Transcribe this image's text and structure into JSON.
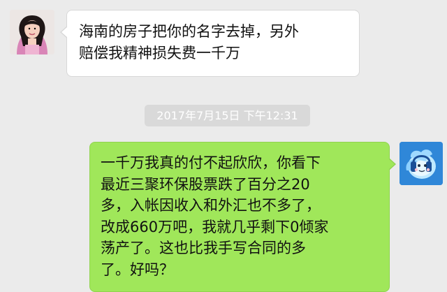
{
  "chat": {
    "timestamp": "2017年7月15日 下午12:31",
    "incoming_message": {
      "lines": [
        "海南的房子把你的名字去掉，另外",
        "赔偿我精神损失费一千万"
      ]
    },
    "outgoing_message": {
      "lines": [
        "一千万我真的付不起欣欣，你看下",
        "最近三聚环保股票跌了百分之20",
        "多，入帐因收入和外汇也不多了，",
        "改成660万吧，我就几乎剩下0倾家",
        "荡产了。这也比我手写合同的多",
        "了。好吗？"
      ]
    }
  },
  "colors": {
    "chat_background": "#ebebeb",
    "incoming_bubble": "#ffffff",
    "outgoing_bubble": "#a0e75a",
    "timestamp_background": "#d9d9d9",
    "timestamp_text": "#ffffff"
  },
  "icons": {
    "left_avatar": "contact-avatar-icon",
    "right_avatar": "user-avatar-icon"
  }
}
